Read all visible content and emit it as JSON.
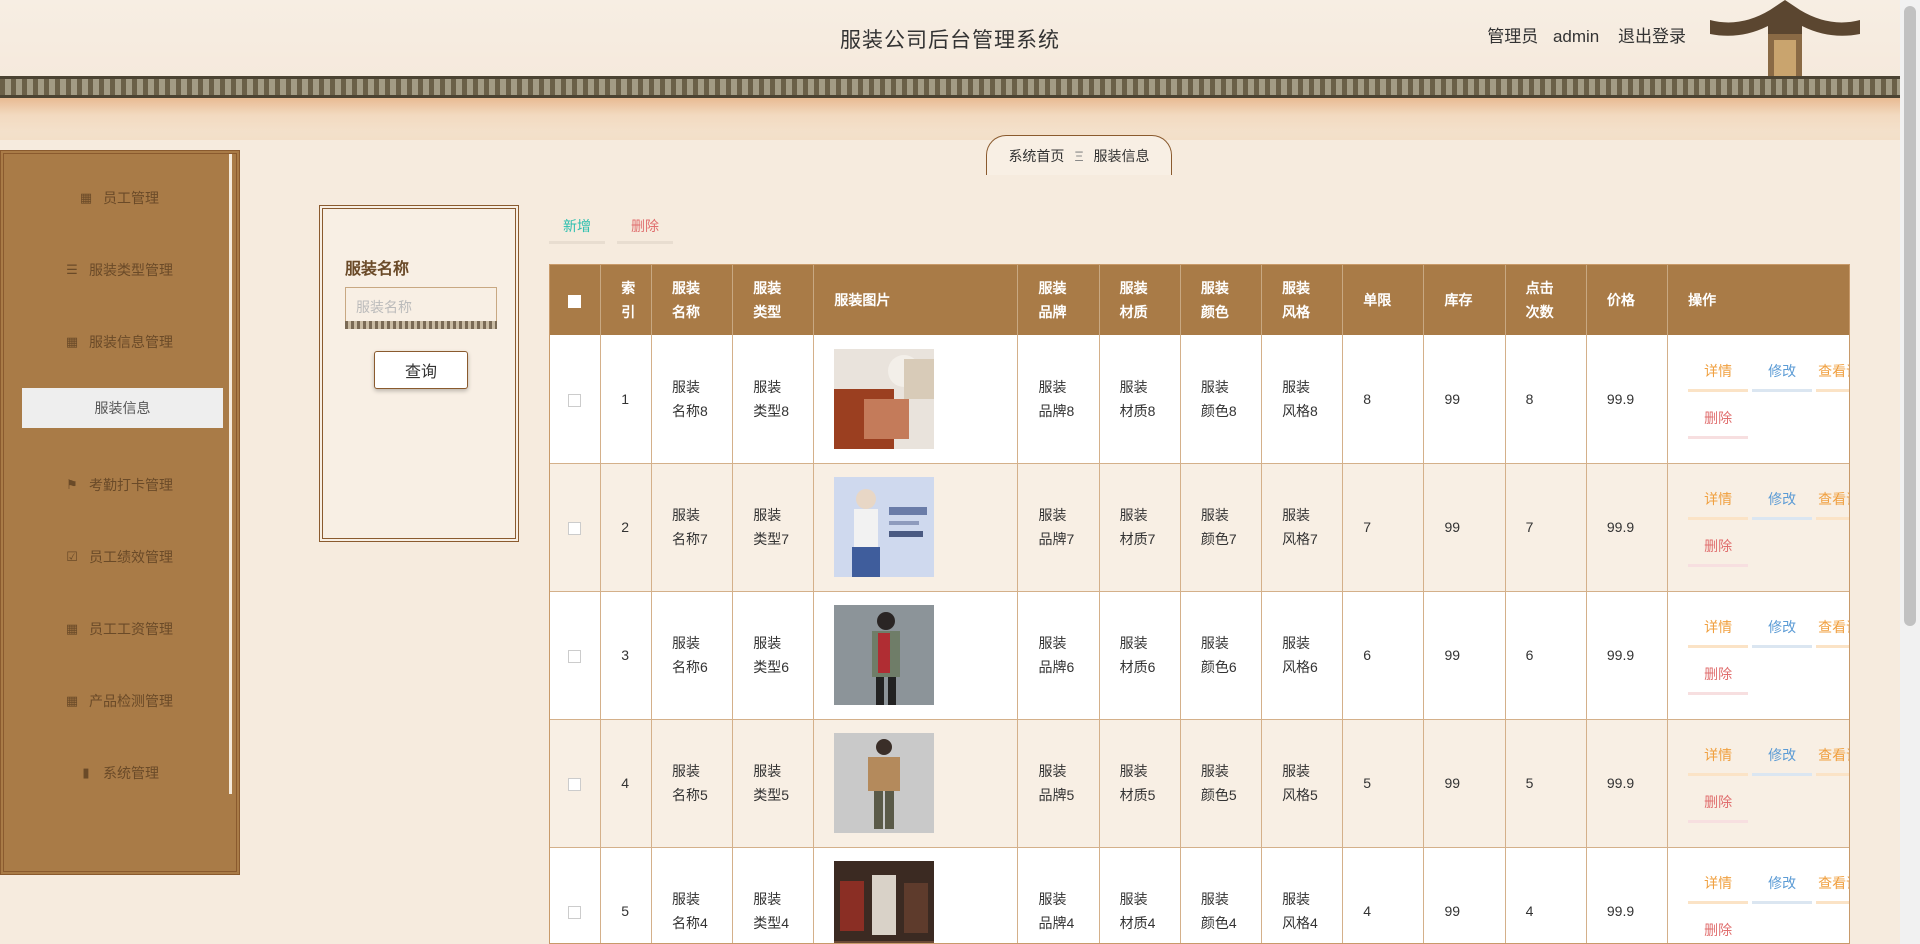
{
  "header": {
    "title": "服装公司后台管理系统",
    "user_role": "管理员",
    "username": "admin",
    "logout": "退出登录"
  },
  "breadcrumb": {
    "home": "系统首页",
    "separator": "Ξ",
    "current": "服装信息"
  },
  "sidebar": {
    "items": [
      {
        "label": "员工管理",
        "icon": "grid-icon"
      },
      {
        "label": "服装类型管理",
        "icon": "sliders-icon"
      },
      {
        "label": "服装信息管理",
        "icon": "grid-icon"
      },
      {
        "label": "服装信息",
        "icon": "",
        "active": true
      },
      {
        "label": "考勤打卡管理",
        "icon": "flag-icon"
      },
      {
        "label": "员工绩效管理",
        "icon": "clipboard-check-icon"
      },
      {
        "label": "员工工资管理",
        "icon": "grid-icon"
      },
      {
        "label": "产品检测管理",
        "icon": "grid-icon"
      },
      {
        "label": "系统管理",
        "icon": "bar-chart-icon"
      }
    ]
  },
  "search": {
    "label": "服装名称",
    "placeholder": "服装名称",
    "button": "查询"
  },
  "actions": {
    "add": "新增",
    "delete": "删除"
  },
  "table": {
    "headers": {
      "index": "索引",
      "name": "服装名称",
      "type": "服装类型",
      "image": "服装图片",
      "brand": "服装品牌",
      "material": "服装材质",
      "color": "服装颜色",
      "style": "服装风格",
      "limit": "单限",
      "stock": "库存",
      "clicks": "点击次数",
      "price": "价格",
      "ops": "操作"
    },
    "ops": {
      "detail": "详情",
      "edit": "修改",
      "view": "查看评论",
      "delete": "删除"
    },
    "rows": [
      {
        "index": "1",
        "name": "服装名称8",
        "type": "服装类型8",
        "brand": "服装品牌8",
        "material": "服装材质8",
        "color": "服装颜色8",
        "style": "服装风格8",
        "limit": "8",
        "stock": "99",
        "clicks": "8",
        "price": "99.9"
      },
      {
        "index": "2",
        "name": "服装名称7",
        "type": "服装类型7",
        "brand": "服装品牌7",
        "material": "服装材质7",
        "color": "服装颜色7",
        "style": "服装风格7",
        "limit": "7",
        "stock": "99",
        "clicks": "7",
        "price": "99.9"
      },
      {
        "index": "3",
        "name": "服装名称6",
        "type": "服装类型6",
        "brand": "服装品牌6",
        "material": "服装材质6",
        "color": "服装颜色6",
        "style": "服装风格6",
        "limit": "6",
        "stock": "99",
        "clicks": "6",
        "price": "99.9"
      },
      {
        "index": "4",
        "name": "服装名称5",
        "type": "服装类型5",
        "brand": "服装品牌5",
        "material": "服装材质5",
        "color": "服装颜色5",
        "style": "服装风格5",
        "limit": "5",
        "stock": "99",
        "clicks": "5",
        "price": "99.9"
      },
      {
        "index": "5",
        "name": "服装名称4",
        "type": "服装类型4",
        "brand": "服装品牌4",
        "material": "服装材质4",
        "color": "服装颜色4",
        "style": "服装风格4",
        "limit": "4",
        "stock": "99",
        "clicks": "4",
        "price": "99.9"
      }
    ]
  },
  "colors": {
    "sidebar_bg": "#a97b47",
    "header_row_bg": "#a97b47",
    "add_btn": "#2bbfae",
    "delete_btn": "#e06e6e",
    "detail_btn": "#f0a040",
    "edit_btn": "#5b9bd5"
  }
}
